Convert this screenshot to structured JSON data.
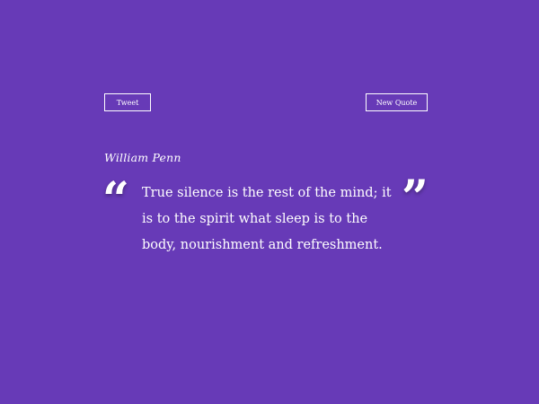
{
  "colors": {
    "background": "#673ab7",
    "text": "#ffffff"
  },
  "actions": {
    "tweet_label": "Tweet",
    "new_quote_label": "New Quote"
  },
  "quote": {
    "author": "William Penn",
    "text": "True silence is the rest of the mind; it is to the spirit what sleep is to the body, nourishment and refreshment.",
    "open_mark": "“",
    "close_mark": "”"
  },
  "icons": {
    "open_quote": "open-quote-icon",
    "close_quote": "close-quote-icon"
  }
}
